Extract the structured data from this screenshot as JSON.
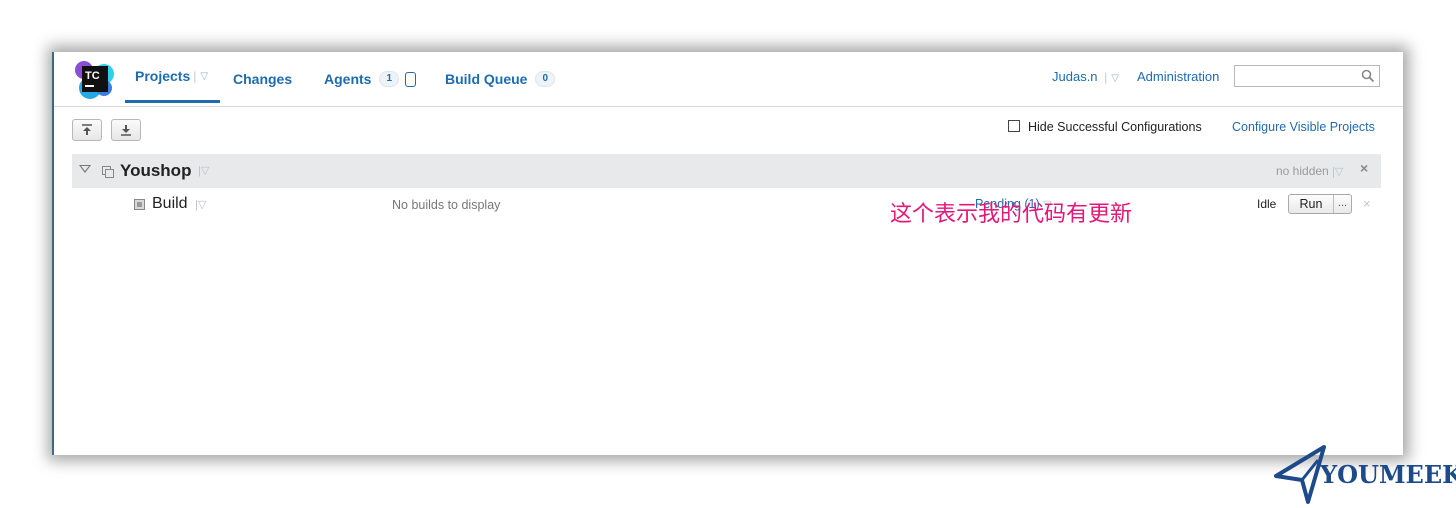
{
  "nav": {
    "logo_text": "TC",
    "tabs": [
      {
        "label": "Projects"
      },
      {
        "label": "Changes"
      },
      {
        "label": "Agents",
        "badge": "1"
      },
      {
        "label": "Build Queue",
        "badge": "0"
      }
    ]
  },
  "header": {
    "user": "Judas.n",
    "administration": "Administration",
    "search_placeholder": ""
  },
  "toolbar": {
    "hide_successful_label": "Hide Successful Configurations",
    "hide_successful_checked": false,
    "configure_link": "Configure Visible Projects"
  },
  "project": {
    "name": "Youshop",
    "hidden_status": "no hidden",
    "close_symbol": "×"
  },
  "build": {
    "name": "Build",
    "no_builds": "No builds to display",
    "pending": "Pending (1)",
    "status": "Idle",
    "run_label": "Run",
    "more_label": "...",
    "close_symbol": "×"
  },
  "annotation": {
    "text": "这个表示我的代码有更新"
  },
  "watermark": {
    "text": "YOUMEEK"
  },
  "colors": {
    "link": "#1f6bb0",
    "annotation": "#e4177a",
    "project_row_bg": "#e8e9ea",
    "watermark": "#1d4a8a"
  }
}
